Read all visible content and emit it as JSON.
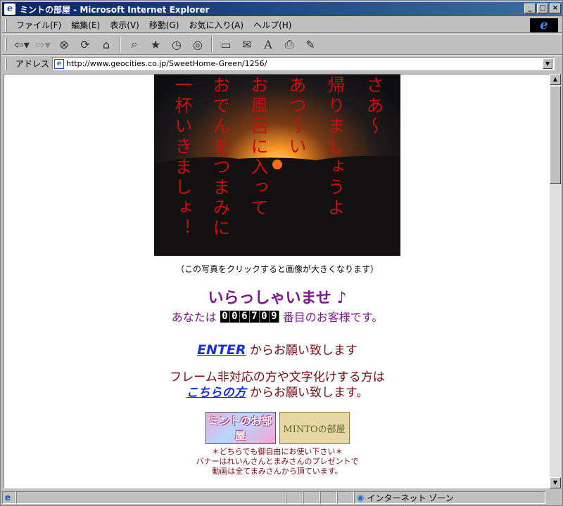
{
  "window": {
    "title": "ミントの部屋 - Microsoft Internet Explorer",
    "buttons": {
      "minimize": "_",
      "maximize": "□",
      "close": "×"
    }
  },
  "menubar": {
    "items": [
      "ファイル(F)",
      "編集(E)",
      "表示(V)",
      "移動(G)",
      "お気に入り(A)",
      "ヘルプ(H)"
    ]
  },
  "toolbar": {
    "icons": [
      "back-icon",
      "forward-icon",
      "stop-icon",
      "refresh-icon",
      "home-icon",
      "search-icon",
      "favorites-icon",
      "history-icon",
      "channels-icon",
      "fullscreen-icon",
      "mail-icon",
      "font-icon",
      "print-icon",
      "edit-icon"
    ]
  },
  "address": {
    "label": "アドレス",
    "url": "http://www.geocities.co.jp/SweetHome-Green/1256/"
  },
  "photo": {
    "poem_lines": [
      "さあ〜",
      "帰りましょうよ",
      "あつ〜い",
      "お風呂に入って",
      "おでんをつまみに",
      "一杯いきましょ！"
    ]
  },
  "page": {
    "caption": "（この写真をクリックすると画像が大きくなります）",
    "welcome": "いらっしゃいませ ♪",
    "visitor_prefix": "あなたは",
    "counter_digits": [
      "0",
      "0",
      "6",
      "7",
      "0",
      "9"
    ],
    "visitor_suffix": "番目のお客様です。",
    "enter_link": "ENTER",
    "enter_suffix": " からお願い致します",
    "noframe_line1": "フレーム非対応の方や文字化けする方は",
    "noframe_link": "こちらの方",
    "noframe_suffix": " からお願い致します。",
    "banner1_text": "ミントのお部屋",
    "banner2_text": "MINTOの部屋",
    "notes": [
      "＊どちらでも御自由にお使い下さい＊",
      "バナーはれいんさんとまみさんのプレゼントで",
      "動画は全てまみさんから頂ています。"
    ]
  },
  "status": {
    "zone": "インターネット ゾーン"
  }
}
